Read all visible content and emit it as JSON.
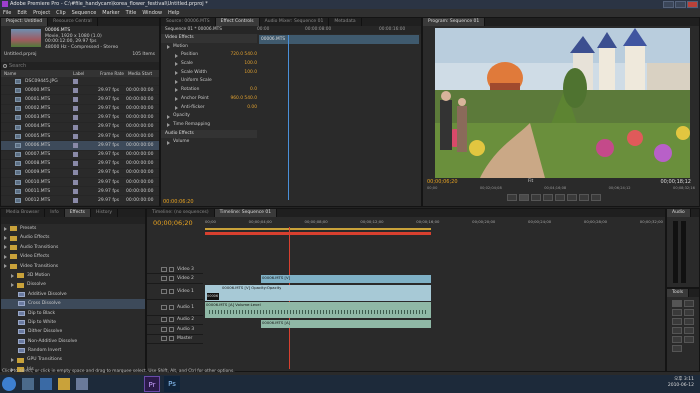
{
  "window": {
    "title": "Adobe Premiere Pro - C:\\#file_handycam\\korea_flower_festival\\Untitled.prproj *"
  },
  "menu": [
    "File",
    "Edit",
    "Project",
    "Clip",
    "Sequence",
    "Marker",
    "Title",
    "Window",
    "Help"
  ],
  "project": {
    "tabs": [
      "Project: Untitled",
      "Resource Central"
    ],
    "clip_name": "00006.MTS",
    "clip_info": [
      "Movie, 1920 x 1080 (1.0)",
      "00:00:12:00, 29.97 fps",
      "48000 Hz - Compressed - Stereo"
    ],
    "project_file": "Untitled.prproj",
    "item_count": "105 Items",
    "search_placeholder": "Search",
    "columns": [
      "Name",
      "Label",
      "Frame Rate",
      "Media Start"
    ],
    "items": [
      {
        "name": "DSC09445.JPG",
        "fps": "",
        "start": ""
      },
      {
        "name": "00000.MTS",
        "fps": "29.97 fps",
        "start": "00:00:00:00"
      },
      {
        "name": "00001.MTS",
        "fps": "29.97 fps",
        "start": "00:00:00:00"
      },
      {
        "name": "00002.MTS",
        "fps": "29.97 fps",
        "start": "00:00:00:00"
      },
      {
        "name": "00003.MTS",
        "fps": "29.97 fps",
        "start": "00:00:00:00"
      },
      {
        "name": "00004.MTS",
        "fps": "29.97 fps",
        "start": "00:00:00:00"
      },
      {
        "name": "00005.MTS",
        "fps": "29.97 fps",
        "start": "00:00:00:00"
      },
      {
        "name": "00006.MTS",
        "fps": "29.97 fps",
        "start": "00:00:00:00"
      },
      {
        "name": "00007.MTS",
        "fps": "29.97 fps",
        "start": "00:00:00:00"
      },
      {
        "name": "00008.MTS",
        "fps": "29.97 fps",
        "start": "00:00:00:00"
      },
      {
        "name": "00009.MTS",
        "fps": "29.97 fps",
        "start": "00:00:00:00"
      },
      {
        "name": "00010.MTS",
        "fps": "29.97 fps",
        "start": "00:00:00:00"
      },
      {
        "name": "00011.MTS",
        "fps": "29.97 fps",
        "start": "00:00:00:00"
      },
      {
        "name": "00012.MTS",
        "fps": "29.97 fps",
        "start": "00:00:00:00"
      }
    ]
  },
  "effect_controls": {
    "tabs": [
      "Source: 00006.MTS",
      "Effect Controls",
      "Audio Mixer: Sequence 01",
      "Metadata"
    ],
    "sequence_label": "Sequence 01 * 00006.MTS",
    "clip_label": "00006.MTS",
    "ruler": [
      "00:00",
      "00:00:08:00",
      "00:00:16:00"
    ],
    "rows": [
      {
        "label": "Video Effects",
        "value": ""
      },
      {
        "label": "Motion",
        "value": ""
      },
      {
        "label": "Position",
        "value": "720.0   540.0"
      },
      {
        "label": "Scale",
        "value": "100.0"
      },
      {
        "label": "Scale Width",
        "value": "100.0"
      },
      {
        "label": "Uniform Scale",
        "value": ""
      },
      {
        "label": "Rotation",
        "value": "0.0"
      },
      {
        "label": "Anchor Point",
        "value": "960.0   540.0"
      },
      {
        "label": "Anti-flicker",
        "value": "0.00"
      },
      {
        "label": "Opacity",
        "value": ""
      },
      {
        "label": "Time Remapping",
        "value": ""
      },
      {
        "label": "Audio Effects",
        "value": ""
      },
      {
        "label": "Volume",
        "value": ""
      }
    ],
    "timecode": "00:00:06:20"
  },
  "program": {
    "tab": "Program: Sequence 01",
    "tc_left": "00;00;06;20",
    "tc_right": "00;00;18;12",
    "fit": "Fit",
    "ruler": [
      "00;00",
      "00;02;04;08",
      "00;04;16;08",
      "00;06;24;12",
      "00;08;32;16"
    ]
  },
  "effects": {
    "tabs": [
      "Media Browser",
      "Info",
      "Effects",
      "History"
    ],
    "items": [
      {
        "label": "Presets",
        "level": 0,
        "kind": "folder"
      },
      {
        "label": "Audio Effects",
        "level": 0,
        "kind": "folder"
      },
      {
        "label": "Audio Transitions",
        "level": 0,
        "kind": "folder"
      },
      {
        "label": "Video Effects",
        "level": 0,
        "kind": "folder"
      },
      {
        "label": "Video Transitions",
        "level": 0,
        "kind": "folder"
      },
      {
        "label": "3D Motion",
        "level": 1,
        "kind": "folder"
      },
      {
        "label": "Dissolve",
        "level": 1,
        "kind": "folder"
      },
      {
        "label": "Additive Dissolve",
        "level": 2,
        "kind": "effect"
      },
      {
        "label": "Cross Dissolve",
        "level": 2,
        "kind": "effect"
      },
      {
        "label": "Dip to Black",
        "level": 2,
        "kind": "effect"
      },
      {
        "label": "Dip to White",
        "level": 2,
        "kind": "effect"
      },
      {
        "label": "Dither Dissolve",
        "level": 2,
        "kind": "effect"
      },
      {
        "label": "Non-Additive Dissolve",
        "level": 2,
        "kind": "effect"
      },
      {
        "label": "Random Invert",
        "level": 2,
        "kind": "effect"
      },
      {
        "label": "GPU Transitions",
        "level": 1,
        "kind": "folder"
      },
      {
        "label": "Iris",
        "level": 1,
        "kind": "folder"
      },
      {
        "label": "Map",
        "level": 1,
        "kind": "folder"
      },
      {
        "label": "Page Peel",
        "level": 1,
        "kind": "folder"
      },
      {
        "label": "Slide",
        "level": 1,
        "kind": "folder"
      }
    ]
  },
  "timeline": {
    "tabs": [
      "Timeline: (no sequences)",
      "Timeline: Sequence 01"
    ],
    "timecode": "00;00;06;20",
    "ruler": [
      "00;00",
      "00;00;04;00",
      "00;00;08;00",
      "00;00;12;00",
      "00;00;16;00",
      "00;00;20;00",
      "00;00;24;00",
      "00;00;28;00",
      "00;00;32;00"
    ],
    "tracks": [
      "Video 3",
      "Video 2",
      "Video 1",
      "Audio 1",
      "Audio 2",
      "Audio 3",
      "Master"
    ],
    "clips": {
      "v2": "00006.MTS [V]",
      "v1": "00006.MTS [V] Opacity:Opacity",
      "v1b": "00006",
      "a1": "00006.MTS [A] Volume:Level",
      "a2": "00006.MTS [A]"
    }
  },
  "audio_panel": {
    "title": "Audio"
  },
  "tools_panel": {
    "title": "Tools"
  },
  "status": "Click to select, or click in empty space and drag to marquee select. Use Shift, Alt, and Ctrl for other options.",
  "taskbar": {
    "time": "오후 3:11",
    "date": "2010-06-12",
    "apps": [
      "Pr",
      "Ps"
    ]
  },
  "colors": {
    "accent": "#e8a321",
    "playhead": "#d8402f",
    "video_clip": "#7fb1c6",
    "audio_clip": "#8fb8a6"
  }
}
